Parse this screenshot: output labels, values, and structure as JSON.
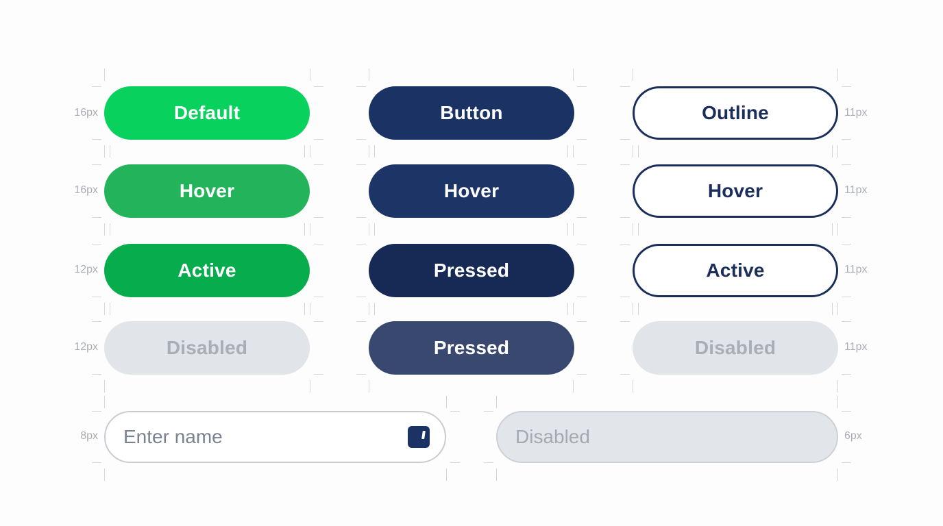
{
  "grid": {
    "rows": [
      {
        "left_size": "16px",
        "right_size": "11px",
        "buttons": [
          "Default",
          "Button",
          "Outline"
        ]
      },
      {
        "left_size": "16px",
        "right_size": "11px",
        "buttons": [
          "Hover",
          "Hover",
          "Hover"
        ]
      },
      {
        "left_size": "12px",
        "right_size": "11px",
        "buttons": [
          "Active",
          "Pressed",
          "Active"
        ]
      },
      {
        "left_size": "12px",
        "right_size": "11px",
        "buttons": [
          "Disabled",
          "Pressed",
          "Disabled"
        ]
      }
    ]
  },
  "inputs": {
    "name_field": {
      "placeholder": "Enter name",
      "icon": "document-icon",
      "size": "8px"
    },
    "disabled_field": {
      "placeholder": "Disabled",
      "size": "6px"
    }
  },
  "colors": {
    "green": "#08d15e",
    "green_hover": "#22b35b",
    "green_active": "#07ad4c",
    "navy": "#1b3264",
    "navy_pressed": "#172a55",
    "navy_light": "#38486f",
    "disabled_bg": "#e1e4e8",
    "disabled_text": "#a9aeb5"
  }
}
